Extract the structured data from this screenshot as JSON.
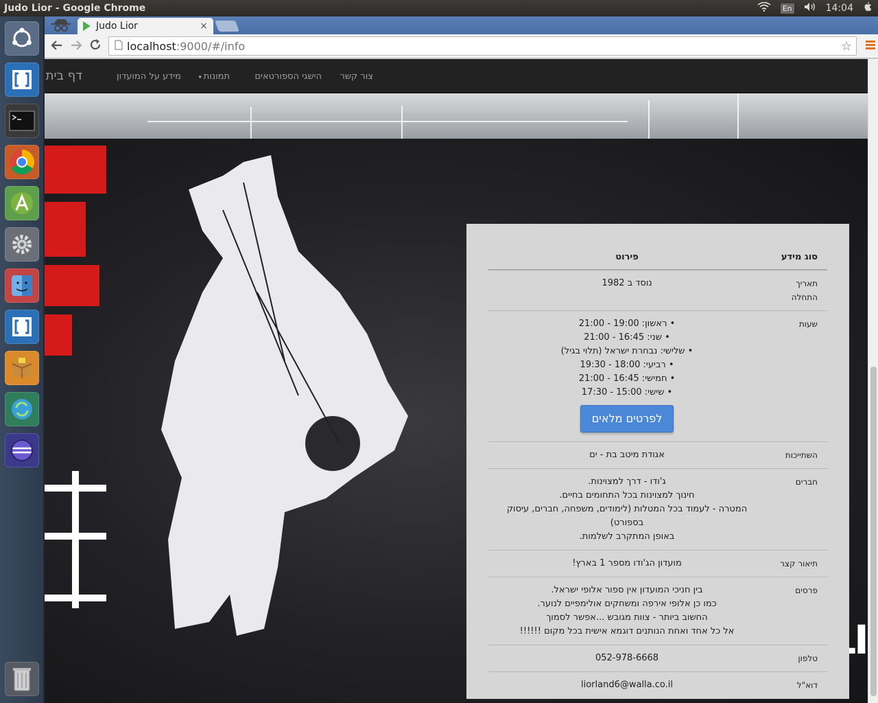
{
  "system": {
    "window_title": "Judo Lior - Google Chrome",
    "keyboard_layout": "En",
    "clock": "14:04"
  },
  "launcher": {
    "icons": [
      "ubuntu-dash-icon",
      "brackets-icon",
      "terminal-icon",
      "chrome-icon",
      "android-studio-icon",
      "settings-icon",
      "finder-icon",
      "brackets-icon",
      "package-icon",
      "sync-icon",
      "eclipse-icon",
      "trash-icon"
    ]
  },
  "browser": {
    "tab_title": "Judo Lior",
    "url_host": "localhost",
    "url_rest": ":9000/#/info"
  },
  "navbar": {
    "brand": "דף בית",
    "items": [
      "מידע על המועדון",
      "תמונות",
      "הישגי הספורטאים",
      "צור קשר"
    ]
  },
  "table": {
    "headers": {
      "type": "סוג מידע",
      "details": "פירוט"
    },
    "rows": {
      "start": {
        "key": "תאריך התחלה",
        "value": "נוסד ב 1982"
      },
      "hours": {
        "key": "שעות",
        "items": [
          "ראשון: 19:00 - 21:00",
          "שני: 16:45 - 21:00",
          "שלישי: נבחרת ישראל (תלוי בגיל)",
          "רביעי: 18:00 - 19:30",
          "חמישי: 16:45 - 21:00",
          "שישי: 15:00 - 17:30"
        ],
        "button": "לפרטים מלאים"
      },
      "affiliation": {
        "key": "השתייכות",
        "value": "אגודת מיטב בת - ים"
      },
      "members": {
        "key": "חברים",
        "lines": [
          "ג'ודו - דרך למצוינות.",
          "חינוך למצוינות בכל התחומים בחיים.",
          "המטרה - לעמוד בכל המטלות (לימודים, משפחה, חברים, עיסוק בספורט)",
          "באופן המתקרב לשלמות."
        ]
      },
      "short": {
        "key": "תיאור קצר",
        "value": "מועדון הג'ודו מספר 1 בארץ!"
      },
      "prizes": {
        "key": "פרסים",
        "lines": [
          "בין חניכי המועדון אין ספור אלופי ישראל.",
          "כמו כן אלופי אירפה ומשחקים אולימפיים לנוער.",
          "החשוב ביותר - צוות מגובש ...אפשר לסמוך",
          "אל כל אחד ואחת הנותנים דוגמא אישית בכל מקום !!!!!!"
        ]
      },
      "phone": {
        "key": "טלפון",
        "value": "052-978-6668"
      },
      "email": {
        "key": "דוא\"ל",
        "value": "liorland6@walla.co.il"
      }
    }
  },
  "poster": {
    "corner_text": "BLI"
  }
}
